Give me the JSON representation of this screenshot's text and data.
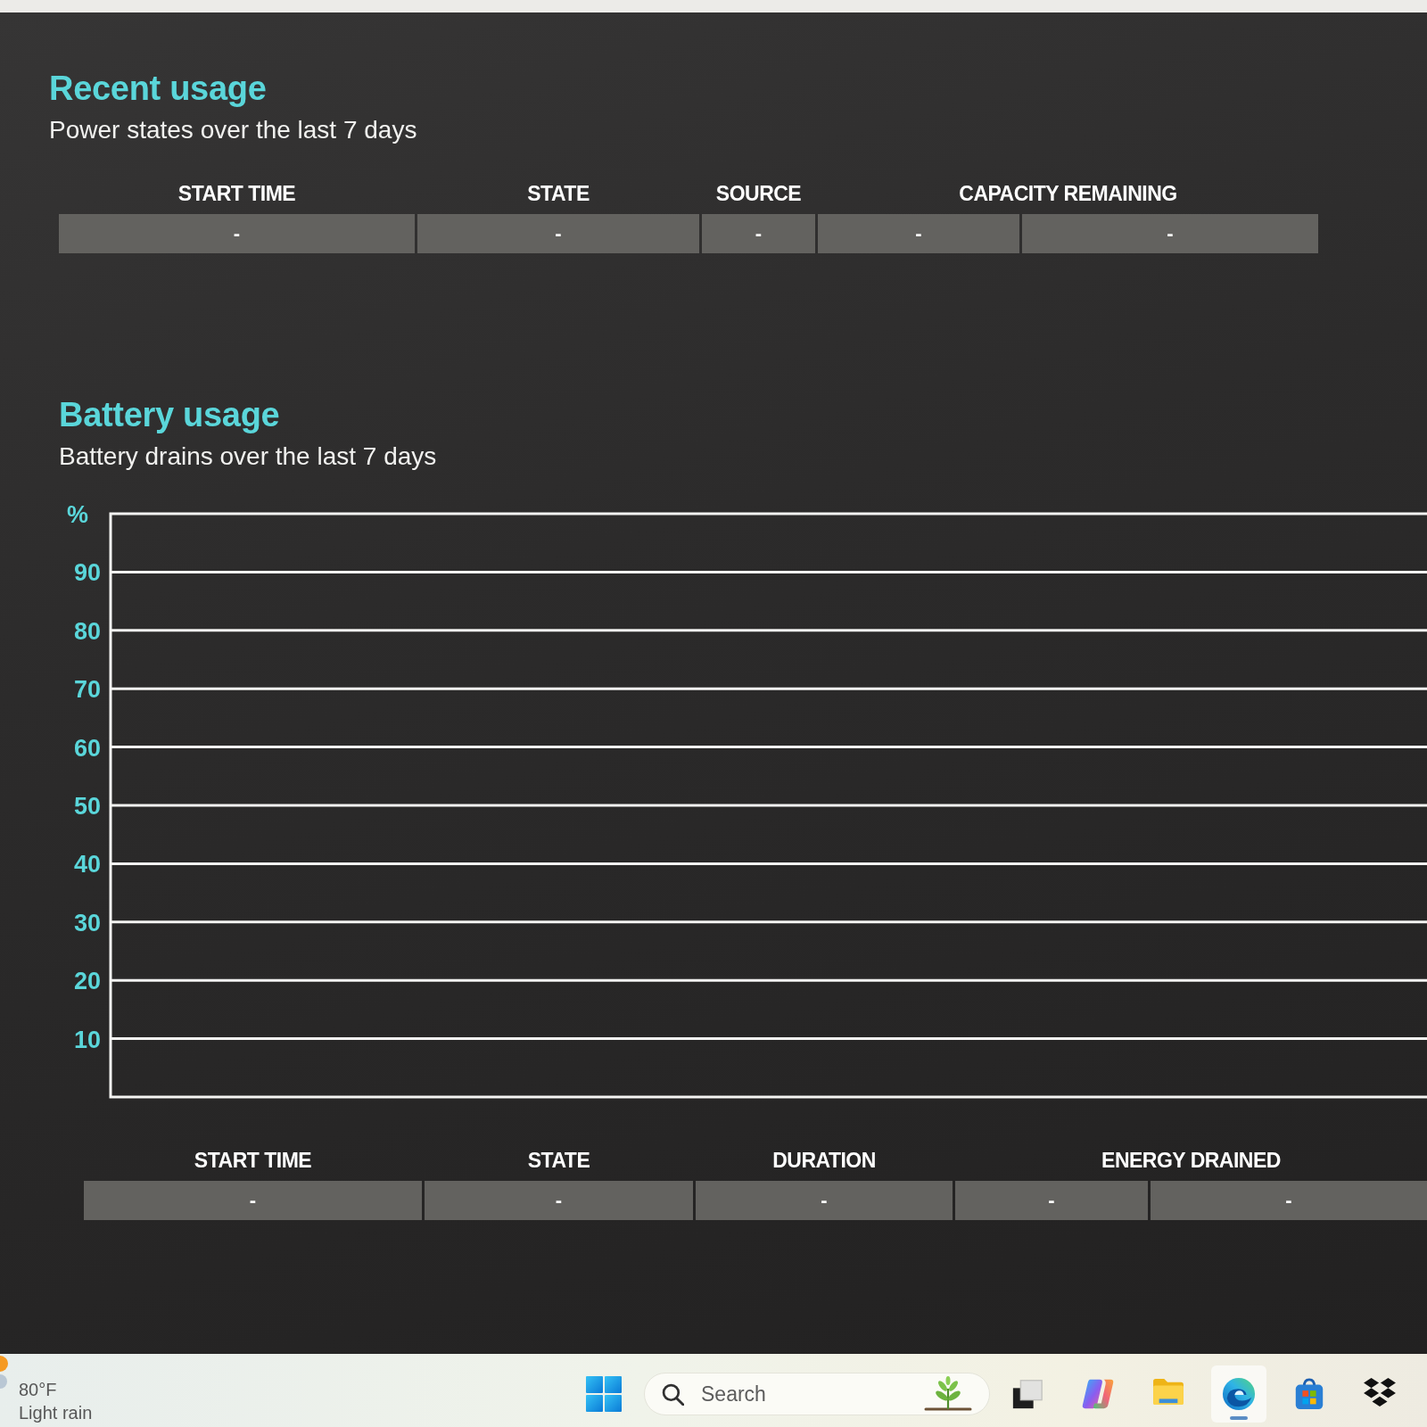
{
  "recent_usage": {
    "title": "Recent usage",
    "subtitle": "Power states over the last 7 days",
    "table": {
      "columns": [
        "START TIME",
        "STATE",
        "SOURCE",
        "",
        "CAPACITY REMAINING"
      ],
      "rows": [
        [
          "-",
          "-",
          "-",
          "-",
          "-"
        ]
      ]
    }
  },
  "battery_usage": {
    "title": "Battery usage",
    "subtitle": "Battery drains over the last 7 days",
    "chart": {
      "axis_label": "%",
      "ticks": [
        "90",
        "80",
        "70",
        "60",
        "50",
        "40",
        "30",
        "20",
        "10"
      ]
    },
    "table": {
      "columns": [
        "START TIME",
        "STATE",
        "DURATION",
        "",
        "ENERGY DRAINED"
      ],
      "rows": [
        [
          "-",
          "-",
          "-",
          "-",
          "-"
        ]
      ]
    }
  },
  "taskbar": {
    "weather": {
      "temperature": "80°F",
      "condition": "Light rain"
    },
    "search": {
      "placeholder": "Search"
    },
    "apps": [
      {
        "kind": "squares",
        "active": false
      },
      {
        "kind": "swirl",
        "active": false
      },
      {
        "kind": "folder",
        "active": false
      },
      {
        "kind": "wave",
        "active": true
      },
      {
        "kind": "bag",
        "active": false
      },
      {
        "kind": "diamonds",
        "active": false
      }
    ]
  }
}
